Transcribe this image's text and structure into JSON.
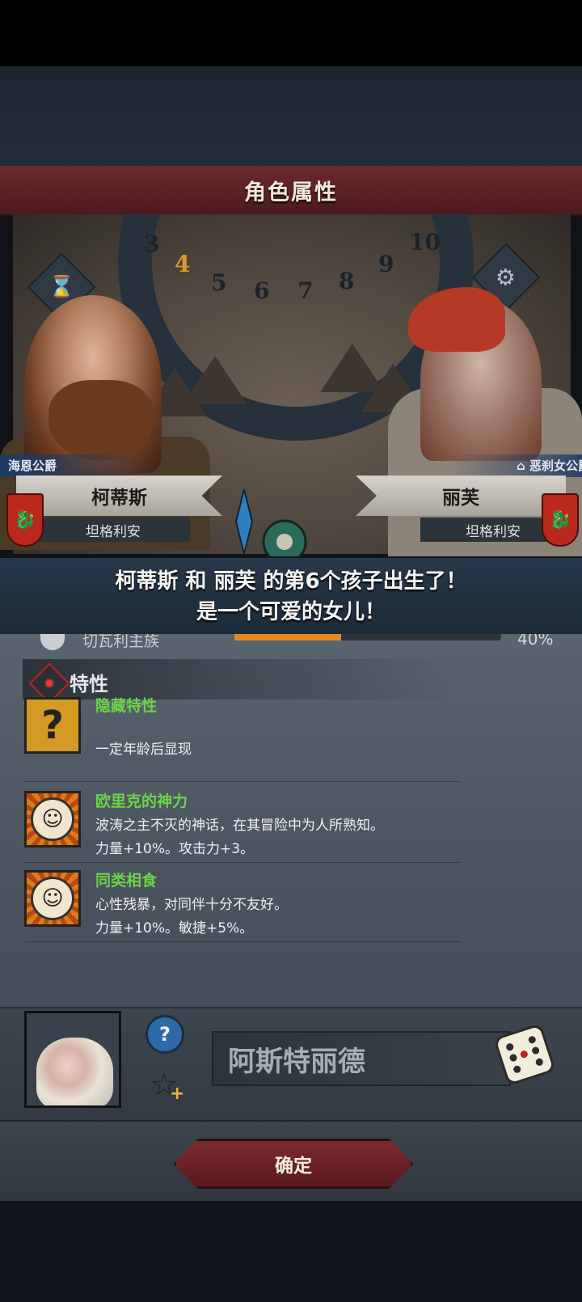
{
  "screen_title": "角色属性",
  "map_wheel_numbers": [
    "3",
    "4",
    "5",
    "6",
    "7",
    "8",
    "9",
    "10"
  ],
  "father": {
    "title": "海恩公爵",
    "name": "柯蒂斯",
    "house": "坦格利安"
  },
  "mother": {
    "title": "恶刹女公爵",
    "name": "丽芙",
    "house": "坦格利安"
  },
  "announcement": {
    "line1": "柯蒂斯 和 丽芙 的第6个孩子出生了！",
    "line2": "是一个可爱的女儿！"
  },
  "faded_stat": {
    "label": "切瓦利主族",
    "value": "40%",
    "fill_fraction": 0.4
  },
  "traits": {
    "header": "特性",
    "items": [
      {
        "name": "隐藏特性",
        "line1": "",
        "line2": "一定年龄后显现",
        "icon": "question-icon"
      },
      {
        "name": "欧里克的神力",
        "line1": "波涛之主不灭的神话，在其冒险中为人所熟知。",
        "line2": "力量+10%。攻击力+3。",
        "icon": "sun-face-icon"
      },
      {
        "name": "同类相食",
        "line1": "心性残暴，对同伴十分不友好。",
        "line2": "力量+10%。敏捷+5%。",
        "icon": "sun-face-icon"
      }
    ]
  },
  "child": {
    "name_value": "阿斯特丽德"
  },
  "buttons": {
    "confirm": "确定"
  },
  "colors": {
    "title_bar": "#6e2a2c",
    "trait_name": "#6bd44a",
    "announce_bg": "#27384a",
    "confirm_bg": "#7b2b2e"
  }
}
